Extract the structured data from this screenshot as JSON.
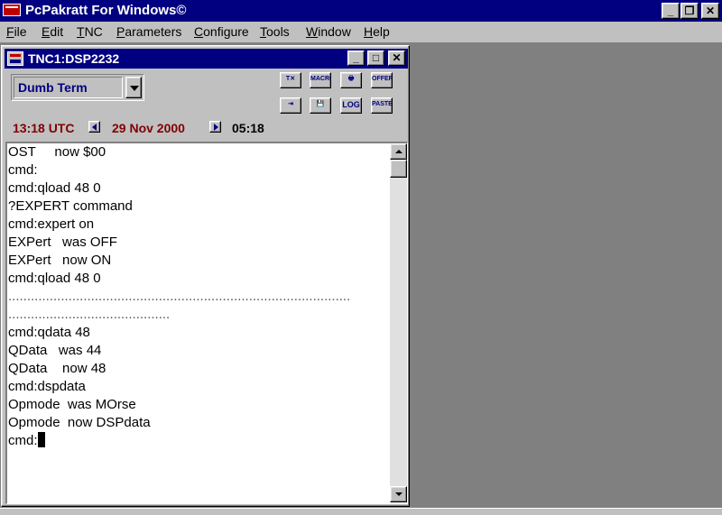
{
  "app": {
    "title": "PcPakratt For Windows©",
    "controls": {
      "minimize": "_",
      "restore": "❐",
      "close": "✕"
    }
  },
  "menu": [
    {
      "label": "File",
      "u": "F",
      "rest": "ile"
    },
    {
      "label": "Edit",
      "u": "E",
      "rest": "dit"
    },
    {
      "label": "TNC",
      "u": "T",
      "rest": "NC"
    },
    {
      "label": "Parameters",
      "u": "P",
      "rest": "arameters"
    },
    {
      "label": "Configure",
      "u": "C",
      "rest": "onfigure"
    },
    {
      "label": "Tools",
      "u": "T",
      "rest": "ools"
    },
    {
      "label": "Window",
      "u": "W",
      "rest": "indow"
    },
    {
      "label": "Help",
      "u": "H",
      "rest": "elp"
    }
  ],
  "window": {
    "title": "TNC1:DSP2232",
    "controls": {
      "minimize": "_",
      "maximize": "□",
      "close": "✕"
    }
  },
  "mode_select": {
    "value": "Dumb Term"
  },
  "toolbar": {
    "buttons": [
      {
        "name": "clear-button",
        "label": "T✕"
      },
      {
        "name": "macro-button",
        "label": "MACRO"
      },
      {
        "name": "print-button",
        "label": "🖶"
      },
      {
        "name": "offer-button",
        "label": "OFFER"
      },
      {
        "name": "receive-button",
        "label": "⇥"
      },
      {
        "name": "save-button",
        "label": "💾"
      },
      {
        "name": "log-button",
        "label": "LOG"
      },
      {
        "name": "paste-button",
        "label": "PASTE"
      }
    ]
  },
  "clock": {
    "utc": "13:18 UTC",
    "date": "29 Nov 2000",
    "local": "05:18"
  },
  "terminal": {
    "lines": [
      "OST     now $00",
      "cmd:",
      "cmd:qload 48 0",
      "?EXPERT command",
      "cmd:expert on",
      "EXPert   was OFF",
      "EXPert   now ON",
      "cmd:qload 48 0",
      "...........................................................................................",
      "...........................................",
      "cmd:qdata 48",
      "QData   was 44",
      "QData    now 48",
      "cmd:dspdata",
      "Opmode  was MOrse",
      "Opmode  now DSPdata"
    ],
    "prompt": "cmd:"
  }
}
